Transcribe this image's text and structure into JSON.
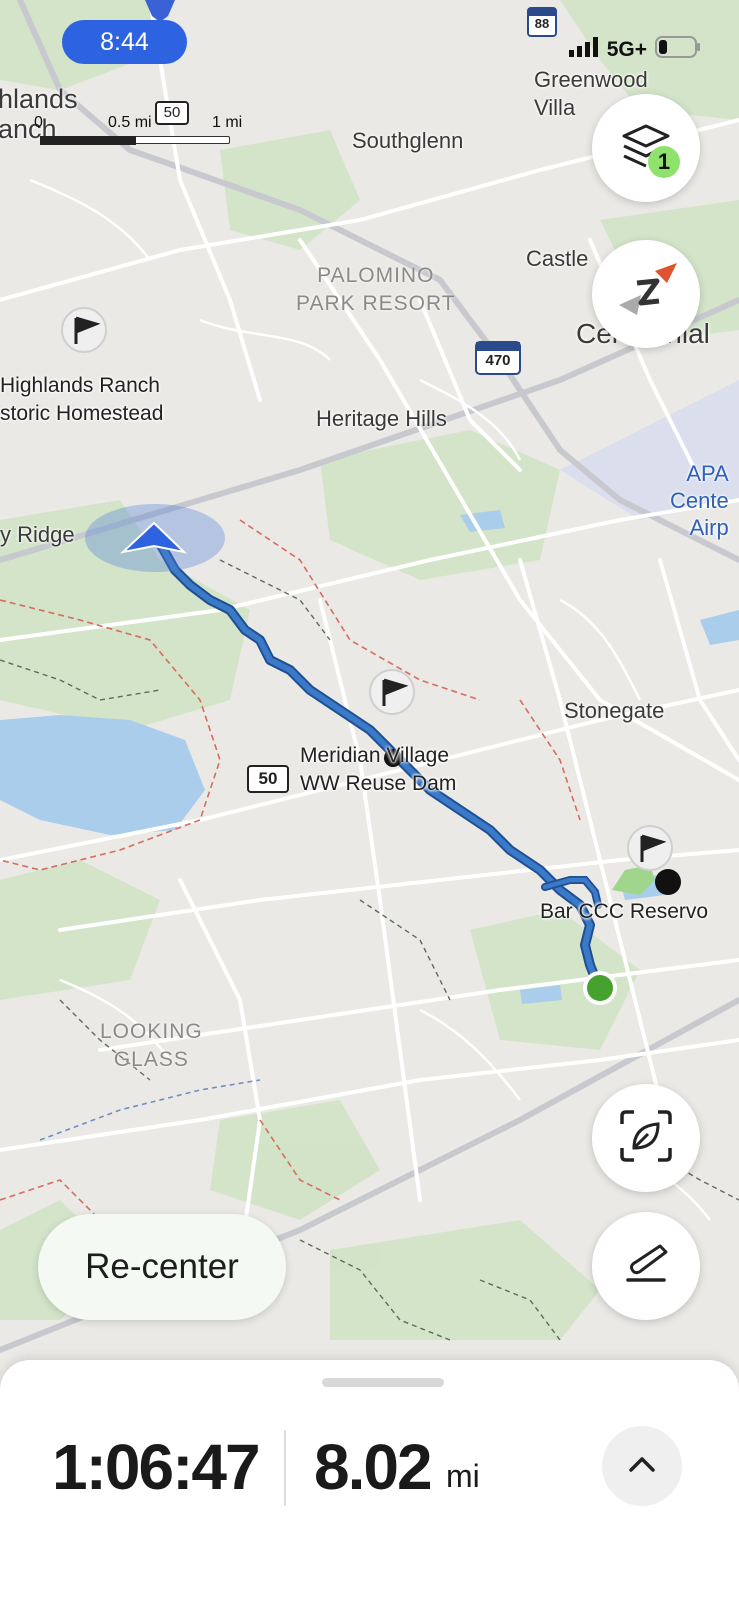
{
  "status_bar": {
    "time": "8:44",
    "signal": "5G+"
  },
  "scale_bar": {
    "zero": "0",
    "half": "0.5 mi",
    "one": "1 mi"
  },
  "map_labels": {
    "highlands_ranch": "hlands\nanch",
    "southglenn": "Southglenn",
    "greenwood": "Greenwood\nVilla",
    "castle": "Castle",
    "centennial": "Centennial",
    "palomino": "PALOMINO\nPARK RESORT",
    "homestead": "Highlands Ranch\nstoric Homestead",
    "heritage_hills": "Heritage Hills",
    "ridge": "y Ridge",
    "apa": "APA\nCente\nAirp",
    "stonegate": "Stonegate",
    "meridian": "Meridian Village\nWW Reuse Dam",
    "bar_ccc": "Bar CCC Reservo",
    "looking_glass": "LOOKING\nGLASS"
  },
  "shields": {
    "i88": "88",
    "us50_top": "50",
    "i470": "470",
    "us50_mid": "50"
  },
  "layers_badge": "1",
  "recenter_label": "Re-center",
  "stats": {
    "elapsed": "1:06:47",
    "distance": "8.02",
    "distance_unit": "mi"
  },
  "icons": {
    "layers": "layers-icon",
    "compass": "compass-icon",
    "scan": "leaf-scan-icon",
    "draw": "draw-route-icon",
    "expand": "chevron-up-icon"
  },
  "colors": {
    "route": "#3a7ac8",
    "accent": "#2d63e0",
    "start": "#46a12f"
  }
}
